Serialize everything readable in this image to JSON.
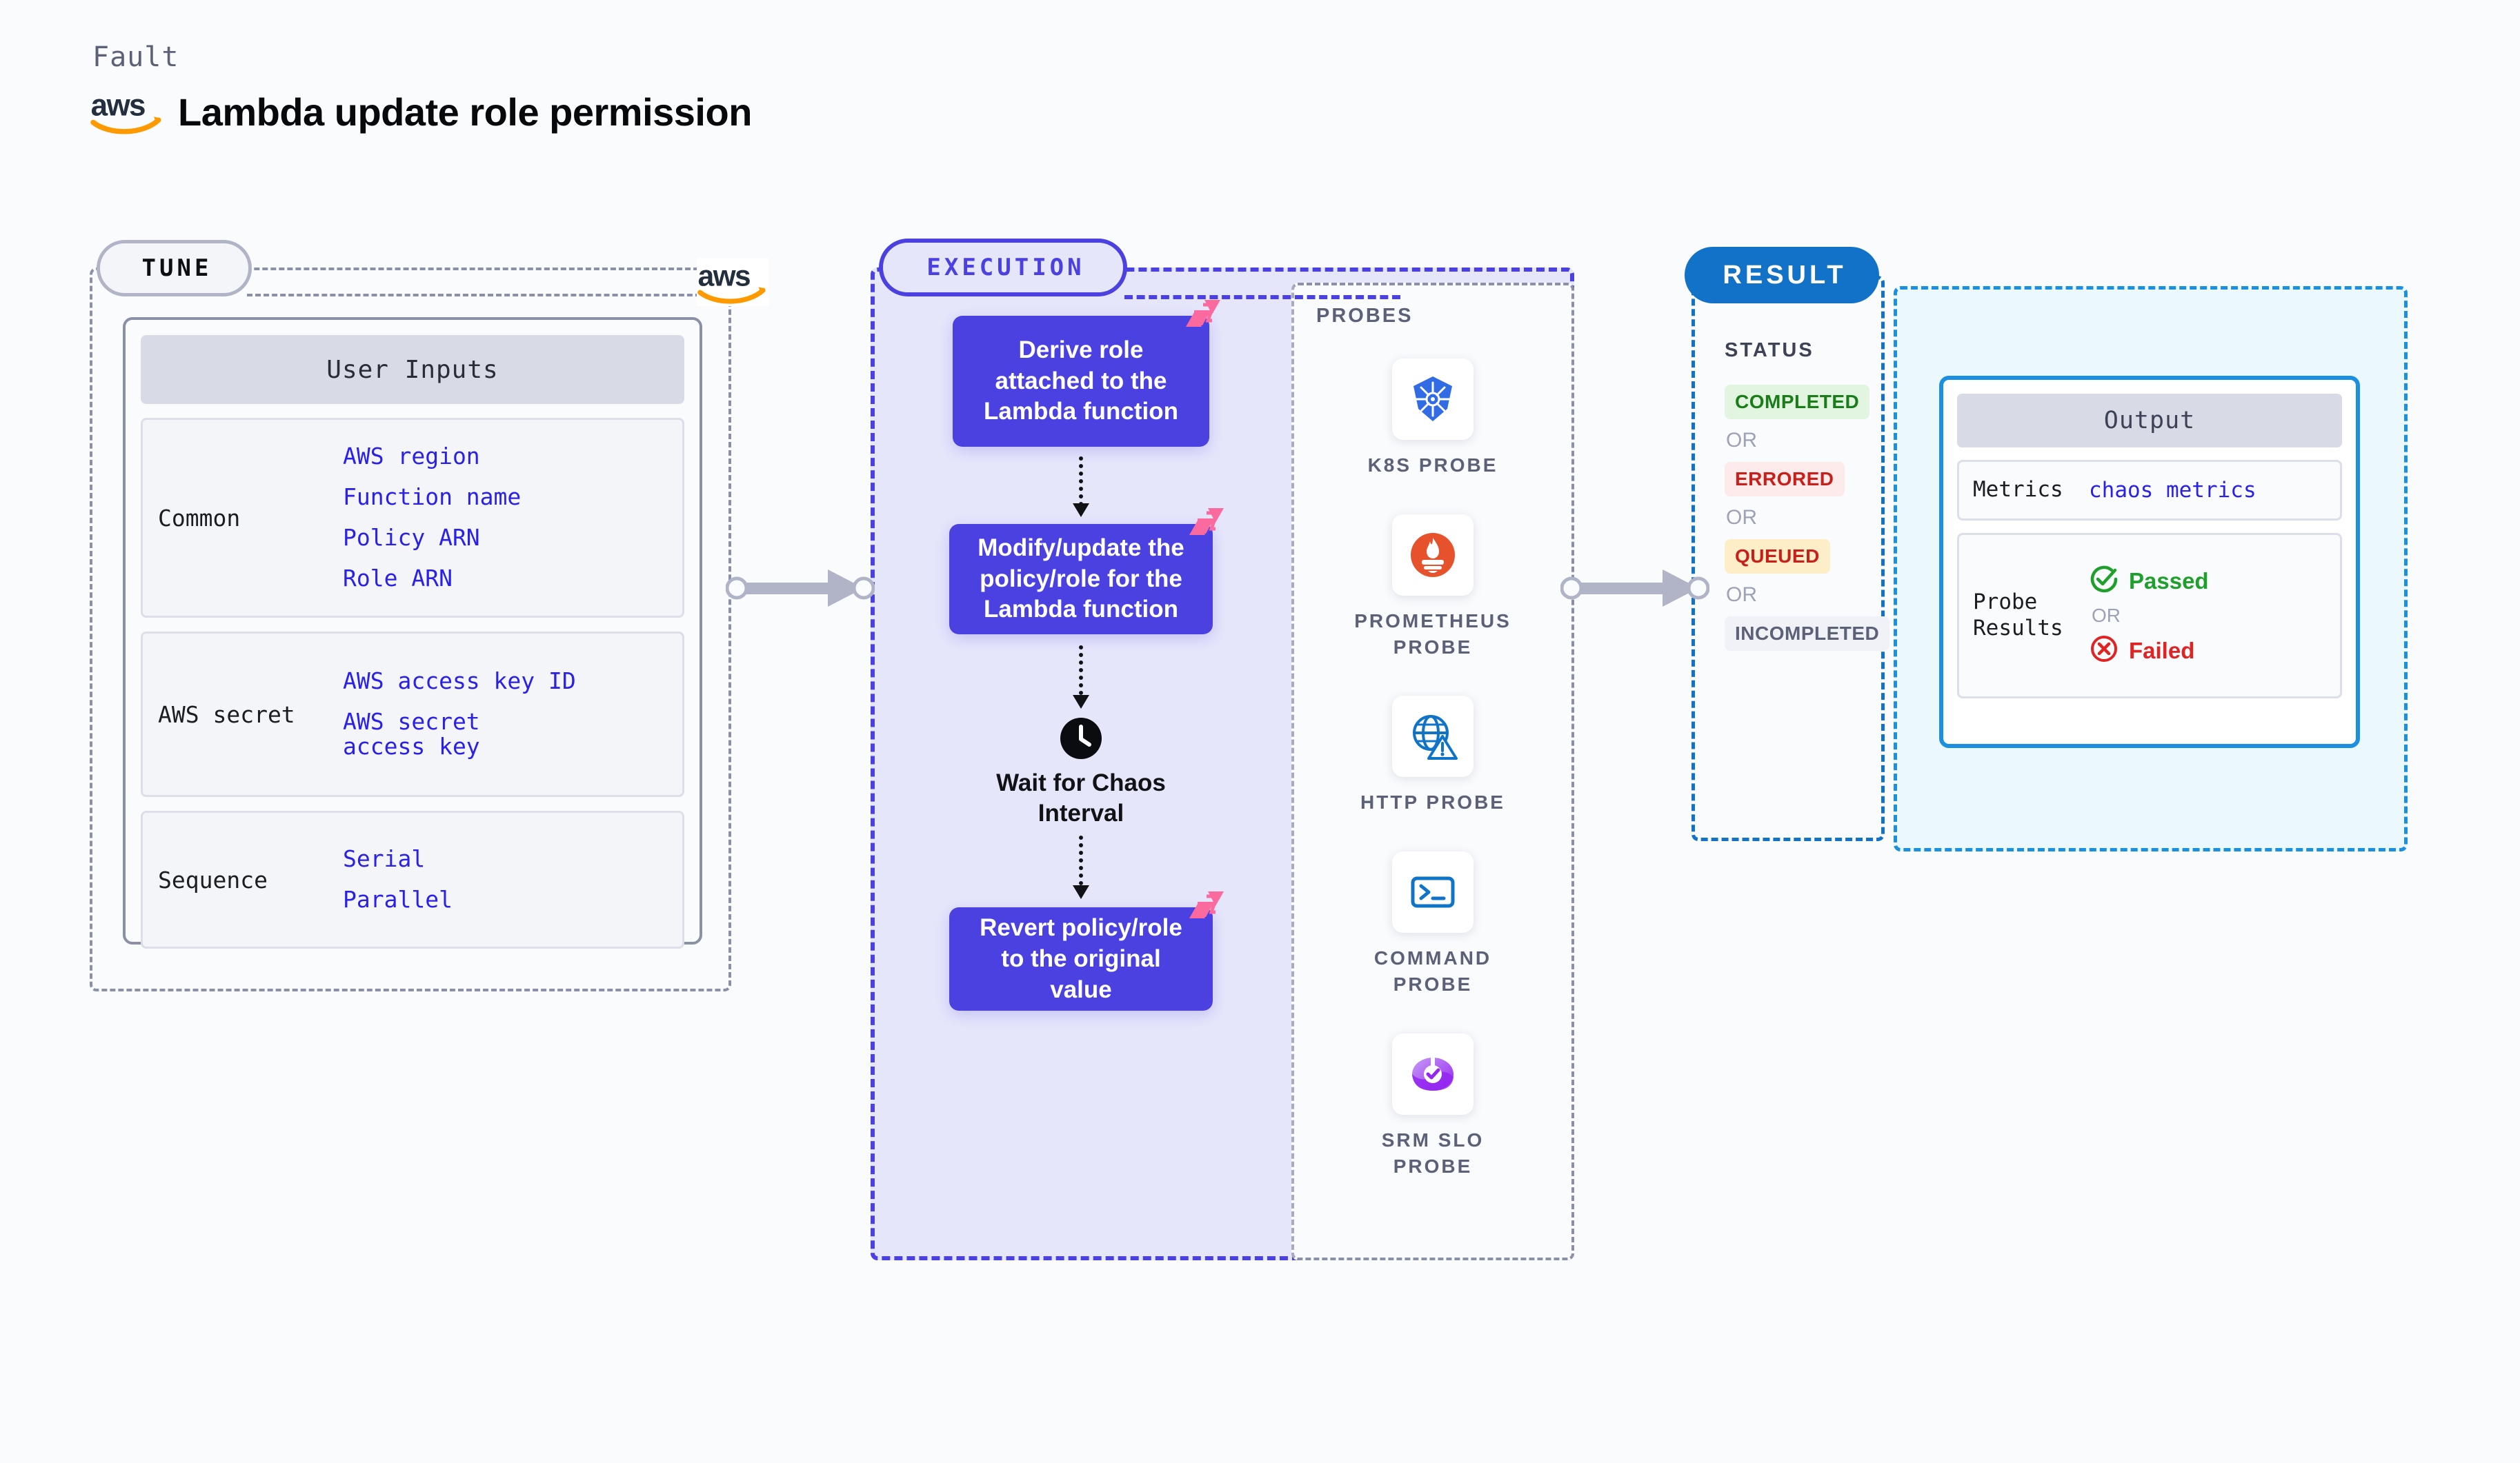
{
  "header": {
    "kicker": "Fault",
    "title": "Lambda update role permission",
    "logo_icon": "aws-logo-icon"
  },
  "tune": {
    "pill_label": "TUNE",
    "aws_badge_icon": "aws-logo-icon",
    "card_title": "User Inputs",
    "groups": [
      {
        "label": "Common",
        "values": [
          "AWS region",
          "Function name",
          "Policy ARN",
          "Role ARN"
        ]
      },
      {
        "label": "AWS secret",
        "values": [
          "AWS access key ID",
          "AWS secret access key"
        ]
      },
      {
        "label": "Sequence",
        "values": [
          "Serial",
          "Parallel"
        ]
      }
    ]
  },
  "connectors": {
    "tune_to_execution_icon": "arrow-right-icon",
    "execution_to_result_icon": "arrow-right-icon"
  },
  "execution": {
    "pill_label": "EXECUTION",
    "steps": [
      {
        "id": "step-1",
        "label": "Derive role attached to the Lambda function",
        "badge_icon": "litmus-icon"
      },
      {
        "id": "step-2",
        "label": "Modify/update the policy/role for the Lambda function",
        "badge_icon": "litmus-icon"
      },
      {
        "id": "step-4",
        "label": "Revert policy/role to the original value",
        "badge_icon": "litmus-icon"
      }
    ],
    "wait": {
      "icon": "clock-icon",
      "label": "Wait for Chaos\nInterval"
    },
    "arrow_icon": "arrow-down-dotted-icon"
  },
  "probes": {
    "section_label": "PROBES",
    "items": [
      {
        "name": "K8S PROBE",
        "icon": "kubernetes-icon"
      },
      {
        "name": "PROMETHEUS\nPROBE",
        "icon": "prometheus-icon"
      },
      {
        "name": "HTTP PROBE",
        "icon": "globe-warning-icon"
      },
      {
        "name": "COMMAND\nPROBE",
        "icon": "terminal-icon"
      },
      {
        "name": "SRM SLO\nPROBE",
        "icon": "srm-slo-icon"
      }
    ]
  },
  "result": {
    "pill_label": "RESULT",
    "status_label": "STATUS",
    "or_label": "OR",
    "statuses": [
      {
        "label": "COMPLETED",
        "bg": "#e2f5e0",
        "fg": "#1a7d1a"
      },
      {
        "label": "ERRORED",
        "bg": "#fdeaea",
        "fg": "#c7201a"
      },
      {
        "label": "QUEUED",
        "bg": "#fdeec8",
        "fg": "#c7201a"
      },
      {
        "label": "INCOMPLETED",
        "bg": "#f1f2f7",
        "fg": "#5c6178"
      }
    ]
  },
  "output": {
    "card_title": "Output",
    "metrics_label": "Metrics",
    "metrics_value": "chaos metrics",
    "probe_results_label": "Probe\nResults",
    "or_label": "OR",
    "passed_label": "Passed",
    "passed_icon": "check-circle-icon",
    "failed_label": "Failed",
    "failed_icon": "x-circle-icon"
  },
  "colors": {
    "accent_indigo": "#4a41e0",
    "accent_blue": "#1172c7",
    "accent_cyan": "#1b8fe0",
    "litmus_pink": "#fb6a9e",
    "gray_dash": "#8b90a6"
  }
}
